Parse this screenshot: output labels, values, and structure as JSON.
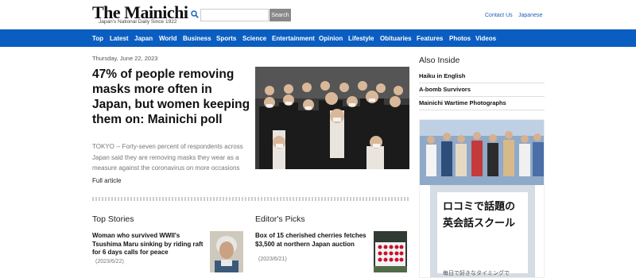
{
  "header": {
    "logo": "The Mainichi",
    "tagline": "Japan's National Daily Since 1922",
    "search_placeholder": "",
    "search_button": "Search",
    "links": [
      "Contact Us",
      "Japanese"
    ]
  },
  "nav": {
    "items": [
      "Top",
      "Latest",
      "Japan",
      "World",
      "Business",
      "Sports",
      "Science",
      "Entertainment",
      "Opinion",
      "Lifestyle",
      "Obituaries",
      "Features",
      "Photos",
      "Videos"
    ]
  },
  "lead": {
    "date": "Thursday, June 22, 2023",
    "headline": "47% of people removing masks more often in Japan, but women keeping them on: Mainichi poll",
    "summary": "TOKYO -- Forty-seven percent of respondents across Japan said they are removing masks they wear as a measure against the coronavirus on more occasions",
    "full_link": "Full article"
  },
  "top_stories": {
    "title": "Top Stories",
    "items": [
      {
        "text": "Woman who survived WWII's Tsushima Maru sinking by riding raft for 6 days calls for peace",
        "date": "(2023/6/22)"
      }
    ]
  },
  "editors_picks": {
    "title": "Editor's Picks",
    "items": [
      {
        "text": "Box of 15 cherished cherries fetches $3,500 at northern Japan auction",
        "date": "(2023/6/21)"
      }
    ]
  },
  "sidebar": {
    "title": "Also Inside",
    "items": [
      "Haiku in English",
      "A-bomb Survivors",
      "Mainichi Wartime Photographs"
    ]
  },
  "ad": {
    "line1": "ロコミで話題の",
    "line2": "英会話スクール",
    "line3": "毎日で好きなタイミングで"
  },
  "colors": {
    "nav_bg": "#0b5ec1",
    "link": "#1a5fb4"
  }
}
